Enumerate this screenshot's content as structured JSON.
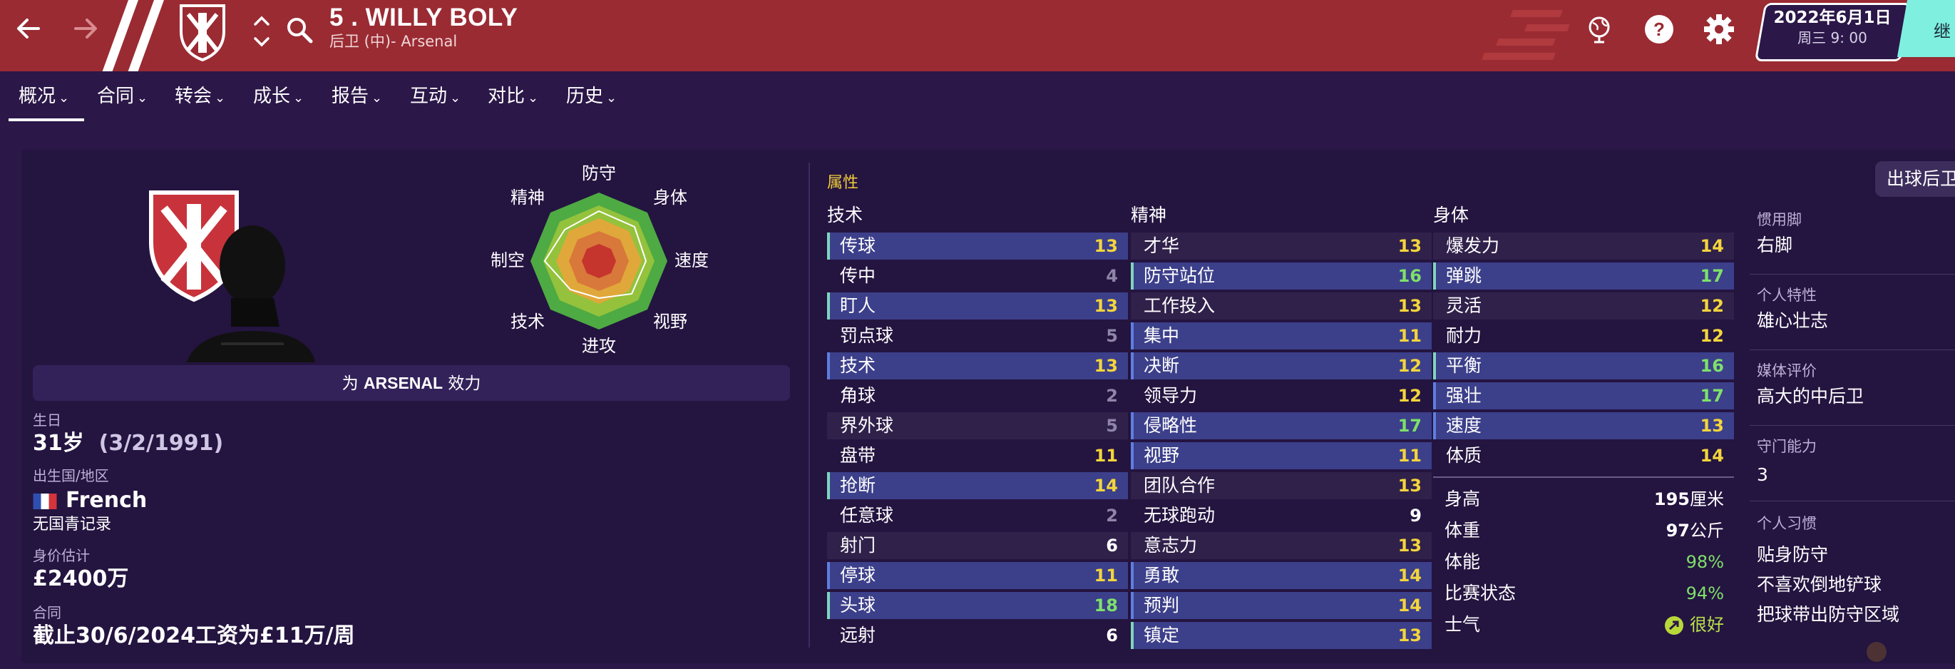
{
  "header": {
    "back_icon": "arrow-left-icon",
    "forward_icon": "arrow-right-icon",
    "player_title": "5 . WILLY BOLY",
    "player_subtitle": "后卫 (中)- Arsenal",
    "date_main": "2022年6月1日",
    "date_time": "周三 9: 00",
    "continue_label": "继",
    "icons": [
      "world-icon",
      "help-icon",
      "settings-icon"
    ],
    "accent_color": "#9a2b33"
  },
  "tabs": [
    {
      "label": "概况"
    },
    {
      "label": "合同"
    },
    {
      "label": "转会"
    },
    {
      "label": "成长"
    },
    {
      "label": "报告"
    },
    {
      "label": "互动"
    },
    {
      "label": "对比"
    },
    {
      "label": "历史"
    }
  ],
  "profile": {
    "plays_for_prefix": "为 ",
    "plays_for_club": "ARSENAL",
    "plays_for_suffix": " 效力",
    "birth_label": "生日",
    "age": "31岁",
    "birth_date": "(3/2/1991)",
    "nation_label": "出生国/地区",
    "nationality": "French",
    "youth_record": "无国青记录",
    "value_label": "身价估计",
    "value": "£2400万",
    "contract_label": "合同",
    "contract": "截止30/6/2024工资为£11万/周"
  },
  "radar": {
    "labels": {
      "top": "防守",
      "top_right": "身体",
      "right": "速度",
      "bottom_right": "视野",
      "bottom": "进攻",
      "bottom_left": "技术",
      "left": "制空",
      "top_left": "精神"
    }
  },
  "attributes": {
    "heading": "属性",
    "technical": {
      "title": "技术",
      "rows": [
        {
          "name": "传球",
          "value": "13"
        },
        {
          "name": "传中",
          "value": "4"
        },
        {
          "name": "盯人",
          "value": "13"
        },
        {
          "name": "罚点球",
          "value": "5"
        },
        {
          "name": "技术",
          "value": "13"
        },
        {
          "name": "角球",
          "value": "2"
        },
        {
          "name": "界外球",
          "value": "5"
        },
        {
          "name": "盘带",
          "value": "11"
        },
        {
          "name": "抢断",
          "value": "14"
        },
        {
          "name": "任意球",
          "value": "2"
        },
        {
          "name": "射门",
          "value": "6"
        },
        {
          "name": "停球",
          "value": "11"
        },
        {
          "name": "头球",
          "value": "18"
        },
        {
          "name": "远射",
          "value": "6"
        }
      ]
    },
    "mental": {
      "title": "精神",
      "rows": [
        {
          "name": "才华",
          "value": "13"
        },
        {
          "name": "防守站位",
          "value": "16"
        },
        {
          "name": "工作投入",
          "value": "13"
        },
        {
          "name": "集中",
          "value": "11"
        },
        {
          "name": "决断",
          "value": "12"
        },
        {
          "name": "领导力",
          "value": "12"
        },
        {
          "name": "侵略性",
          "value": "17"
        },
        {
          "name": "视野",
          "value": "11"
        },
        {
          "name": "团队合作",
          "value": "13"
        },
        {
          "name": "无球跑动",
          "value": "9"
        },
        {
          "name": "意志力",
          "value": "13"
        },
        {
          "name": "勇敢",
          "value": "14"
        },
        {
          "name": "预判",
          "value": "14"
        },
        {
          "name": "镇定",
          "value": "13"
        }
      ]
    },
    "physical": {
      "title": "身体",
      "rows": [
        {
          "name": "爆发力",
          "value": "14"
        },
        {
          "name": "弹跳",
          "value": "17"
        },
        {
          "name": "灵活",
          "value": "12"
        },
        {
          "name": "耐力",
          "value": "12"
        },
        {
          "name": "平衡",
          "value": "16"
        },
        {
          "name": "强壮",
          "value": "17"
        },
        {
          "name": "速度",
          "value": "13"
        },
        {
          "name": "体质",
          "value": "14"
        }
      ],
      "stats": [
        {
          "label": "身高",
          "value": "195",
          "unit": "厘米"
        },
        {
          "label": "体重",
          "value": "97",
          "unit": "公斤"
        },
        {
          "label": "体能",
          "value": "98%",
          "unit": ""
        },
        {
          "label": "比赛状态",
          "value": "94%",
          "unit": ""
        },
        {
          "label": "士气",
          "value": "很好",
          "unit": ""
        }
      ]
    }
  },
  "side_info": {
    "role_chip": "出球后卫",
    "foot_label": "惯用脚",
    "foot_value": "右脚",
    "traits_label": "个人特性",
    "traits_value": "雄心壮志",
    "media_label": "媒体评价",
    "media_value": "高大的中后卫",
    "gk_label": "守门能力",
    "gk_value": "3",
    "habits_label": "个人习惯",
    "habits": [
      "贴身防守",
      "不喜欢倒地铲球",
      "把球带出防守区域"
    ]
  }
}
